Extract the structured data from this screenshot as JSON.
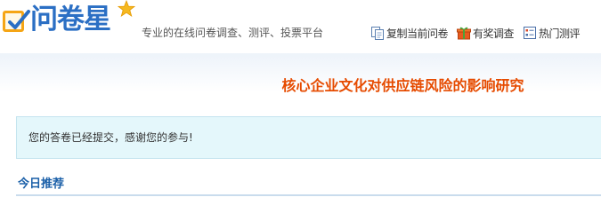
{
  "header": {
    "logo_text": "问卷星",
    "slogan": "专业的在线问卷调查、测评、投票平台",
    "links": [
      {
        "label": "复制当前问卷",
        "icon": "copy-icon"
      },
      {
        "label": "有奖调查",
        "icon": "gift-icon"
      },
      {
        "label": "热门测评",
        "icon": "checklist-icon"
      }
    ]
  },
  "survey": {
    "title": "核心企业文化对供应链风险的影响研究"
  },
  "message": {
    "text": "您的答卷已经提交，感谢您的参与!"
  },
  "recommend": {
    "title": "今日推荐"
  },
  "colors": {
    "brand_blue": "#2b6fc4",
    "logo_orange": "#f5a515",
    "title_orange": "#e64b00",
    "message_bg": "#e4f7fb",
    "section_blue": "#1a5fa8"
  }
}
